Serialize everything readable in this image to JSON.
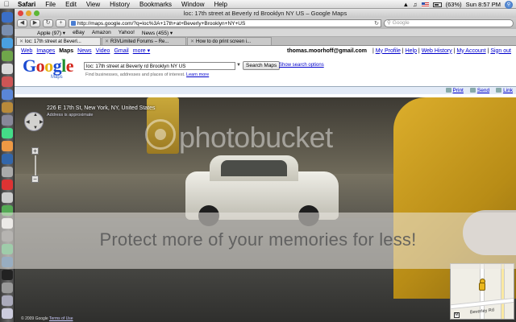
{
  "menubar": {
    "app": "Safari",
    "menus": [
      "File",
      "Edit",
      "View",
      "History",
      "Bookmarks",
      "Window",
      "Help"
    ],
    "battery": "(63%)",
    "clock": "Sun 8:57 PM"
  },
  "window": {
    "title": "loc: 17th street at Beverly rd Brooklyn NY US – Google Maps",
    "url": "http://maps.google.com/?q=loc%3A+17th+at+Beverly+Brooklyn+NY+US",
    "search_placeholder": "Google"
  },
  "bookmarks": [
    "Apple (97) ▾",
    "eBay",
    "Amazon",
    "Yahoo!",
    "News (455) ▾"
  ],
  "tabs": [
    {
      "label": "loc: 17th street at Beverl..."
    },
    {
      "label": "R3VLimited Forums – Re..."
    },
    {
      "label": "How to do print screen i..."
    }
  ],
  "gbar": {
    "links": [
      "Web",
      "Images"
    ],
    "active": "Maps",
    "links2": [
      "News",
      "Video",
      "Gmail",
      "more ▾"
    ],
    "user": "thomas.moorhoff@gmail.com",
    "right_links": [
      "My Profile",
      "Help",
      "Web History",
      "My Account",
      "Sign out"
    ]
  },
  "logo": {
    "text": "Google",
    "sub": "Maps"
  },
  "search": {
    "query": "loc: 17th street at Beverly rd Brooklyn NY US",
    "button": "Search Maps",
    "options": "Show search options",
    "hint": "Find businesses, addresses and places of interest.",
    "hint_link": "Learn more"
  },
  "actions": [
    "Print",
    "Send",
    "Link"
  ],
  "streetview": {
    "address": "226 E 17th St, New York, NY, United States",
    "sub": "Address is approximate",
    "copyright": "© 2009 Google",
    "terms": "Terms of Use"
  },
  "minimap": {
    "road_label": "Beverley Rd",
    "metro": "M"
  },
  "watermark": {
    "logo": "photobucket",
    "band": "Protect more of your memories for less!"
  }
}
